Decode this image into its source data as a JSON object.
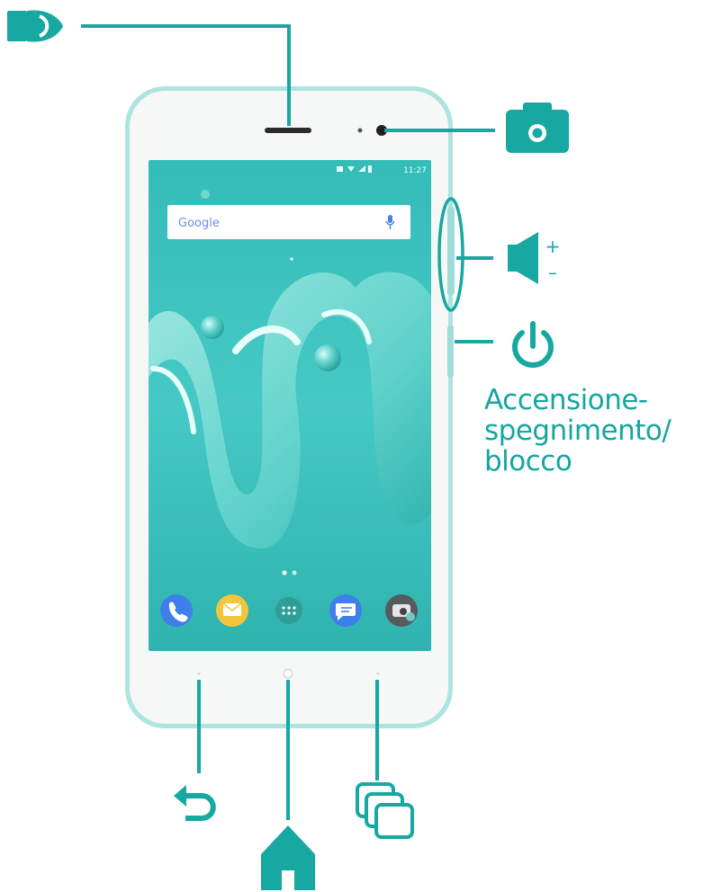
{
  "colors": {
    "accent": "#16a8a1",
    "phone_body": "#f4f6f5",
    "phone_trim": "#a9e3df",
    "screen_bg": "#3ec3bf"
  },
  "icons": {
    "earpiece": "speaker-icon",
    "front_camera": "camera-icon",
    "volume": "volume-up-down-icon",
    "power": "power-icon",
    "back": "back-arrow-icon",
    "home": "home-icon",
    "recents": "recent-apps-icon"
  },
  "screen": {
    "search_brand": "Google",
    "status_time": "11:27"
  },
  "labels": {
    "power_line1": "Accensione-",
    "power_line2": "spegnimento/",
    "power_line3": "blocco"
  },
  "volume_signs": {
    "plus": "+",
    "minus": "–"
  }
}
